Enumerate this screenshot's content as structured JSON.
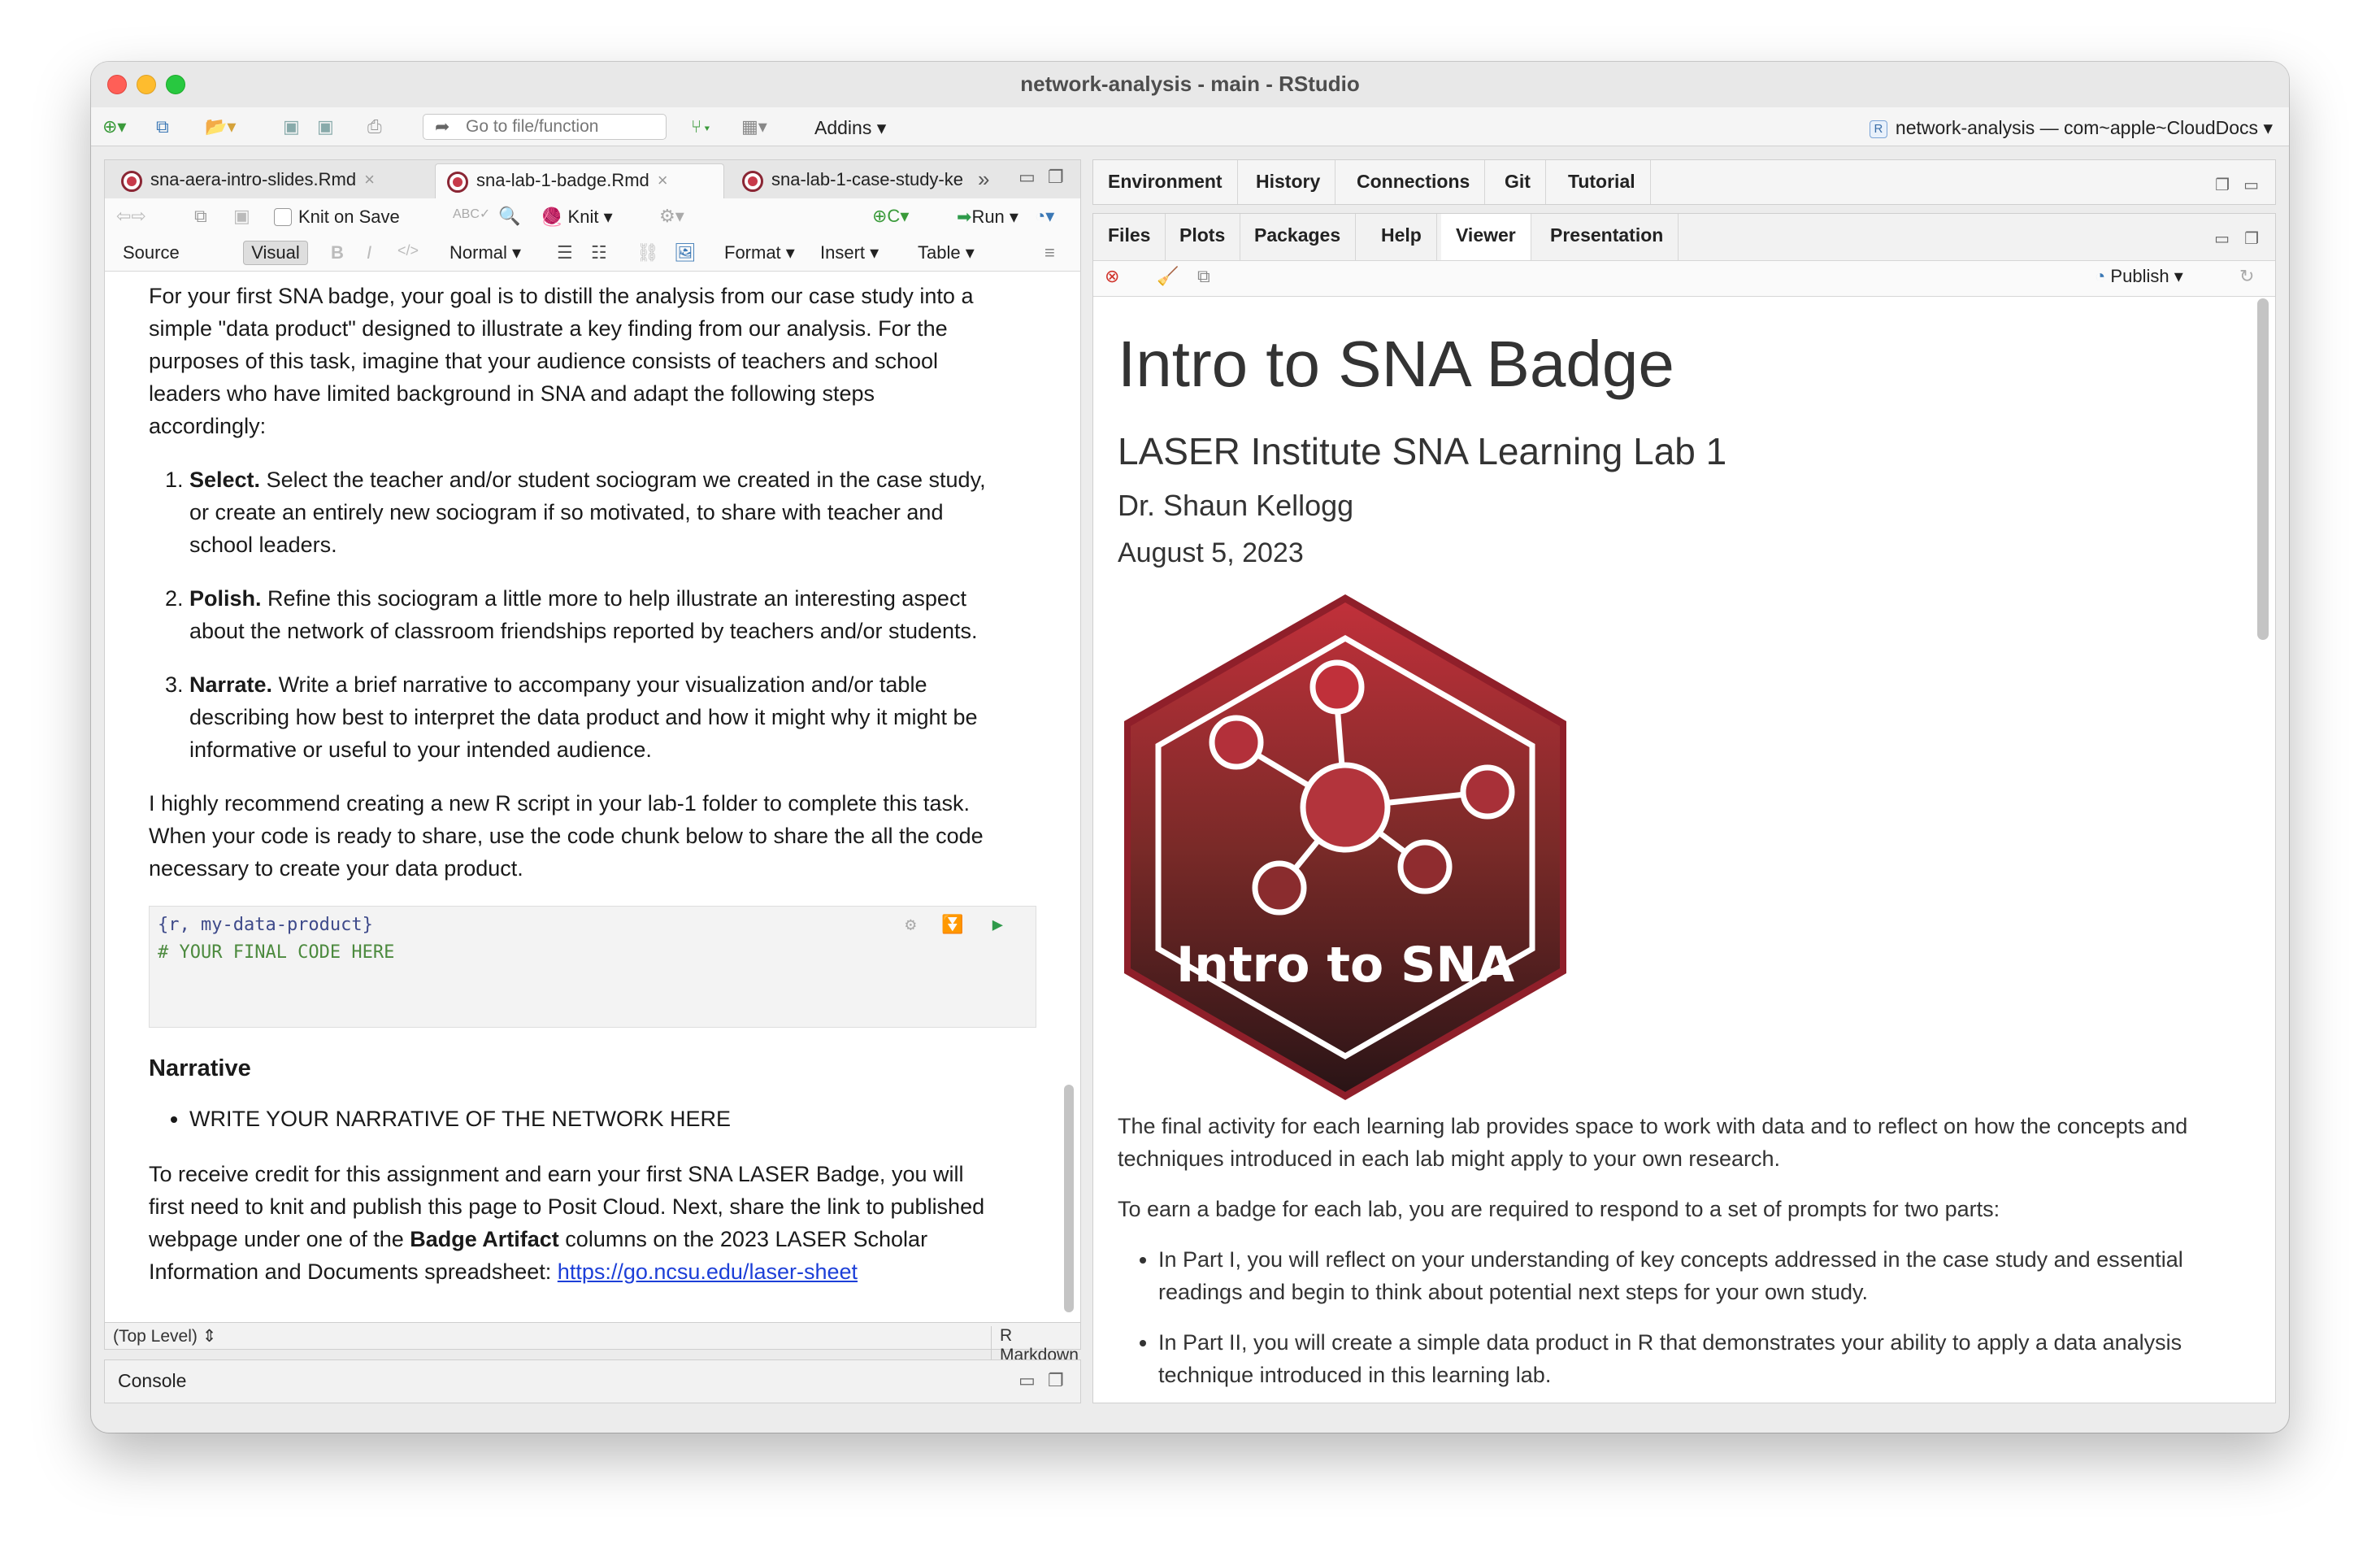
{
  "window": {
    "title": "network-analysis - main - RStudio"
  },
  "toolbar": {
    "goto_placeholder": "Go to file/function",
    "addins_label": "Addins",
    "project_label": "network-analysis — com~apple~CloudDocs"
  },
  "source_tabs": [
    {
      "label": "sna-aera-intro-slides.Rmd",
      "active": false
    },
    {
      "label": "sna-lab-1-badge.Rmd",
      "active": true
    },
    {
      "label": "sna-lab-1-case-study-ke",
      "active": false
    }
  ],
  "editor_toolbar": {
    "knit_on_save": "Knit on Save",
    "knit": "Knit",
    "run": "Run",
    "source": "Source",
    "visual": "Visual",
    "style": "Normal",
    "format": "Format",
    "insert": "Insert",
    "table": "Table"
  },
  "editor": {
    "intro": "For your first SNA badge, your goal is to distill the analysis from our case study into a simple \"data product\" designed to illustrate a key finding from our analysis. For the purposes of this task, imagine that your audience consists of teachers and school leaders who have limited background in SNA and adapt the following steps accordingly:",
    "steps": [
      {
        "bold": "Select.",
        "text": " Select the teacher and/or student sociogram we created in the case study, or create an entirely new sociogram if so motivated, to share with teacher and school leaders."
      },
      {
        "bold": "Polish.",
        "text": " Refine this sociogram a little more to help illustrate an interesting aspect about the network of classroom friendships reported by teachers and/or students."
      },
      {
        "bold": "Narrate.",
        "text": " Write a brief narrative to accompany your visualization and/or table describing how best to interpret the data product and how it might why it might be informative or useful to your intended audience."
      }
    ],
    "recommend": "I highly recommend creating a new R script in your lab-1 folder to complete this task. When your code is ready to share, use the code chunk below to share the all the code necessary to create your data product.",
    "chunk_header": "{r, my-data-product}",
    "chunk_comment": "# YOUR FINAL CODE HERE",
    "narrative_heading": "Narrative",
    "narrative_item": "WRITE YOUR NARRATIVE OF THE NETWORK HERE",
    "credit_1": "To receive credit for this assignment and earn your first SNA LASER Badge, you will first need to knit and publish this page to Posit Cloud. Next, share the link to published webpage under one of the ",
    "credit_bold": "Badge Artifact",
    "credit_2": " columns on the 2023 LASER Scholar Information and Documents spreadsheet: ",
    "credit_link": "https://go.ncsu.edu/laser-sheet"
  },
  "status": {
    "level": "(Top Level) ⇕",
    "mode": "R Markdown ⇕"
  },
  "console": {
    "label": "Console"
  },
  "right_top_tabs": [
    "Environment",
    "History",
    "Connections",
    "Git",
    "Tutorial"
  ],
  "right_bottom_tabs": [
    "Files",
    "Plots",
    "Packages",
    "Help",
    "Viewer",
    "Presentation"
  ],
  "right_active_tab": "Viewer",
  "viewer_toolbar": {
    "publish": "Publish"
  },
  "viewer": {
    "title": "Intro to SNA Badge",
    "subtitle": "LASER Institute SNA Learning Lab 1",
    "author": "Dr. Shaun Kellogg",
    "date": "August 5, 2023",
    "badge_text": "Intro to SNA",
    "p1": "The final activity for each learning lab provides space to work with data and to reflect on how the concepts and techniques introduced in each lab might apply to your own research.",
    "p2": "To earn a badge for each lab, you are required to respond to a set of prompts for two parts:",
    "bullets": [
      "In Part I, you will reflect on your understanding of key concepts addressed in the case study and essential readings and begin to think about potential next steps for your own study.",
      "In Part II, you will create a simple data product in R that demonstrates your ability to apply a data analysis technique introduced in this learning lab."
    ]
  },
  "colors": {
    "badge_top": "#c0303a",
    "badge_bottom": "#2a1416",
    "badge_border": "#8f1f2a",
    "link": "#1c3fd8"
  }
}
